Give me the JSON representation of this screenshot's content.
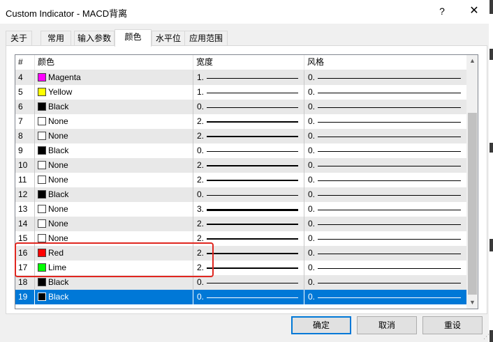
{
  "window": {
    "title": "Custom Indicator - MACD背离",
    "help_label": "?",
    "close_label": "✕"
  },
  "tabs": [
    {
      "label": "关于"
    },
    {
      "label": "常用"
    },
    {
      "label": "输入参数"
    },
    {
      "label": "颜色",
      "active": true
    },
    {
      "label": "水平位"
    },
    {
      "label": "应用范围"
    }
  ],
  "table": {
    "headers": {
      "num": "#",
      "color": "颜色",
      "width": "宽度",
      "style": "风格"
    },
    "rows": [
      {
        "num": "4",
        "color_name": "Magenta",
        "swatch": "#ff00ff",
        "width": "1.",
        "width_value": 1,
        "style": "0."
      },
      {
        "num": "5",
        "color_name": "Yellow",
        "swatch": "#ffff00",
        "width": "1.",
        "width_value": 1,
        "style": "0."
      },
      {
        "num": "6",
        "color_name": "Black",
        "swatch": "#000000",
        "width": "0.",
        "width_value": 0,
        "style": "0."
      },
      {
        "num": "7",
        "color_name": "None",
        "swatch": "#ffffff",
        "width": "2.",
        "width_value": 2,
        "style": "0."
      },
      {
        "num": "8",
        "color_name": "None",
        "swatch": "#ffffff",
        "width": "2.",
        "width_value": 2,
        "style": "0."
      },
      {
        "num": "9",
        "color_name": "Black",
        "swatch": "#000000",
        "width": "0.",
        "width_value": 0,
        "style": "0."
      },
      {
        "num": "10",
        "color_name": "None",
        "swatch": "#ffffff",
        "width": "2.",
        "width_value": 2,
        "style": "0."
      },
      {
        "num": "11",
        "color_name": "None",
        "swatch": "#ffffff",
        "width": "2.",
        "width_value": 2,
        "style": "0."
      },
      {
        "num": "12",
        "color_name": "Black",
        "swatch": "#000000",
        "width": "0.",
        "width_value": 0,
        "style": "0."
      },
      {
        "num": "13",
        "color_name": "None",
        "swatch": "#ffffff",
        "width": "3.",
        "width_value": 3,
        "style": "0."
      },
      {
        "num": "14",
        "color_name": "None",
        "swatch": "#ffffff",
        "width": "2.",
        "width_value": 2,
        "style": "0."
      },
      {
        "num": "15",
        "color_name": "None",
        "swatch": "#ffffff",
        "width": "2.",
        "width_value": 2,
        "style": "0."
      },
      {
        "num": "16",
        "color_name": "Red",
        "swatch": "#ff0000",
        "width": "2.",
        "width_value": 2,
        "style": "0."
      },
      {
        "num": "17",
        "color_name": "Lime",
        "swatch": "#00ff00",
        "width": "2.",
        "width_value": 2,
        "style": "0."
      },
      {
        "num": "18",
        "color_name": "Black",
        "swatch": "#000000",
        "width": "0.",
        "width_value": 0,
        "style": "0."
      },
      {
        "num": "19",
        "color_name": "Black",
        "swatch": "#000000",
        "width": "0.",
        "width_value": 0,
        "style": "0.",
        "selected": true
      }
    ]
  },
  "scrollbar": {
    "up_icon": "▲",
    "down_icon": "▼"
  },
  "buttons": {
    "ok": "确定",
    "cancel": "取消",
    "reset": "重设"
  },
  "colors": {
    "selection": "#0078d7",
    "annotation": "#e0261f"
  }
}
